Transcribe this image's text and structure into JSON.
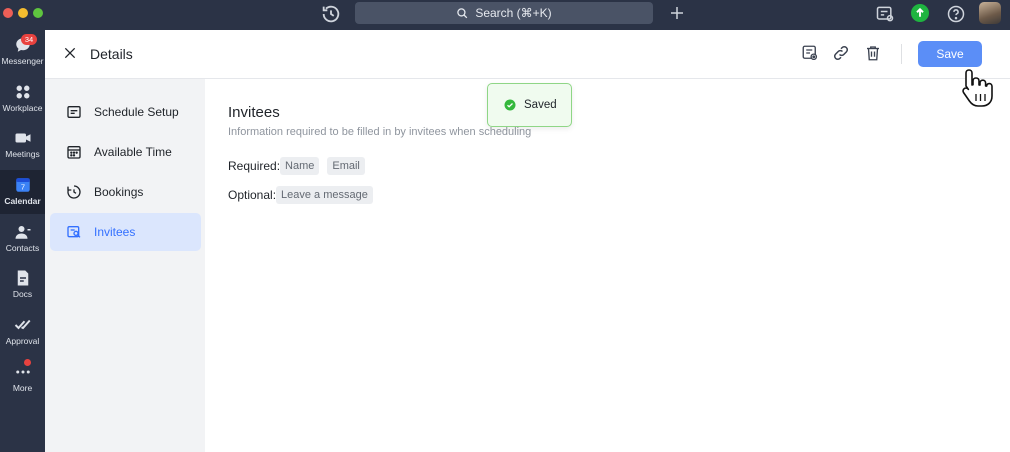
{
  "topbar": {
    "search_label": "Search (⌘+K)"
  },
  "rail": {
    "items": [
      {
        "label": "Messenger",
        "badge": "34"
      },
      {
        "label": "Workplace"
      },
      {
        "label": "Meetings"
      },
      {
        "label": "Calendar",
        "day": "7"
      },
      {
        "label": "Contacts"
      },
      {
        "label": "Docs"
      },
      {
        "label": "Approval"
      },
      {
        "label": "More"
      }
    ]
  },
  "header": {
    "title": "Details",
    "save_label": "Save"
  },
  "sidenav": {
    "items": [
      {
        "label": "Schedule Setup"
      },
      {
        "label": "Available Time"
      },
      {
        "label": "Bookings"
      },
      {
        "label": "Invitees",
        "active": true
      }
    ]
  },
  "content": {
    "title": "Invitees",
    "description": "Information required to be filled in by invitees when scheduling",
    "required_label": "Required:",
    "required_fields": [
      "Name",
      "Email"
    ],
    "optional_label": "Optional:",
    "optional_fields": [
      "Leave a message"
    ]
  },
  "toast": {
    "text": "Saved"
  },
  "colors": {
    "accent": "#5b8ef7",
    "active_nav_bg": "#dbe6fd",
    "toast_border": "#8fd686",
    "badge_red": "#e8423f",
    "rail_bg": "#2b3346"
  }
}
